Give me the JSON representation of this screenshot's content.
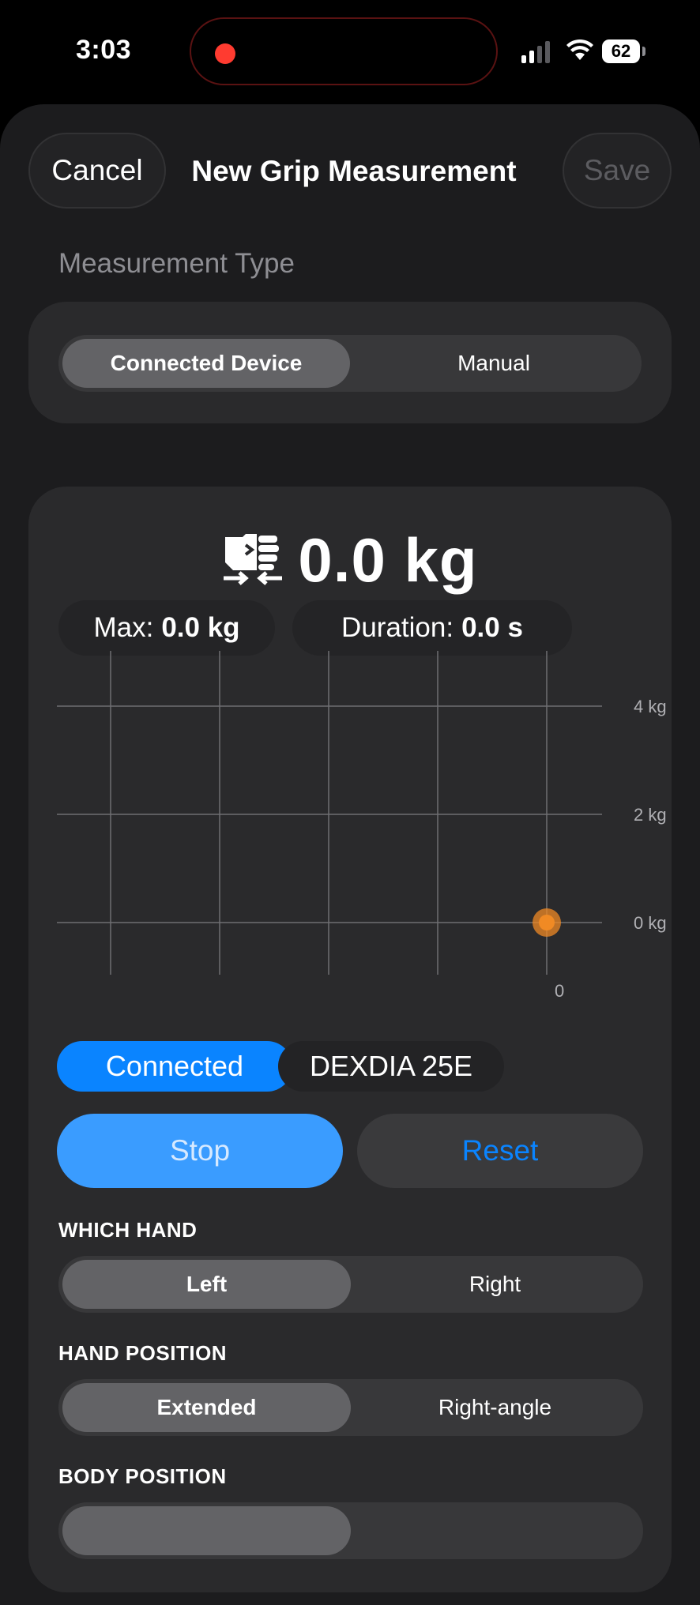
{
  "status_bar": {
    "time": "3:03",
    "battery": "62"
  },
  "nav": {
    "cancel": "Cancel",
    "title": "New Grip Measurement",
    "save": "Save"
  },
  "measurement_type": {
    "label": "Measurement Type",
    "options": [
      "Connected Device",
      "Manual"
    ],
    "selected": "Connected Device"
  },
  "reading": {
    "value": "0.0 kg",
    "icon": "hand-grip-icon"
  },
  "stats": {
    "max_label": "Max:",
    "max_value": "0.0 kg",
    "duration_label": "Duration:",
    "duration_value": "0.0 s"
  },
  "chart_data": {
    "type": "line",
    "series": [
      {
        "x": [
          0
        ],
        "y": [
          0
        ]
      }
    ],
    "y_ticks": [
      "4 kg",
      "2 kg",
      "0 kg"
    ],
    "y_tick_values": [
      4,
      2,
      0
    ],
    "x_ticks": [
      "0"
    ],
    "grid": true,
    "point_color": "#f08a24"
  },
  "device": {
    "status": "Connected",
    "name": "DEXDIA 25E"
  },
  "actions": {
    "stop": "Stop",
    "reset": "Reset"
  },
  "which_hand": {
    "label": "WHICH HAND",
    "options": [
      "Left",
      "Right"
    ],
    "selected": "Left"
  },
  "hand_position": {
    "label": "HAND POSITION",
    "options": [
      "Extended",
      "Right-angle"
    ],
    "selected": "Extended"
  },
  "body_position": {
    "label": "BODY POSITION"
  },
  "colors": {
    "accent": "#0a84ff",
    "sheet": "#1c1c1e",
    "card": "#2a2a2c",
    "marker": "#f08a24"
  }
}
